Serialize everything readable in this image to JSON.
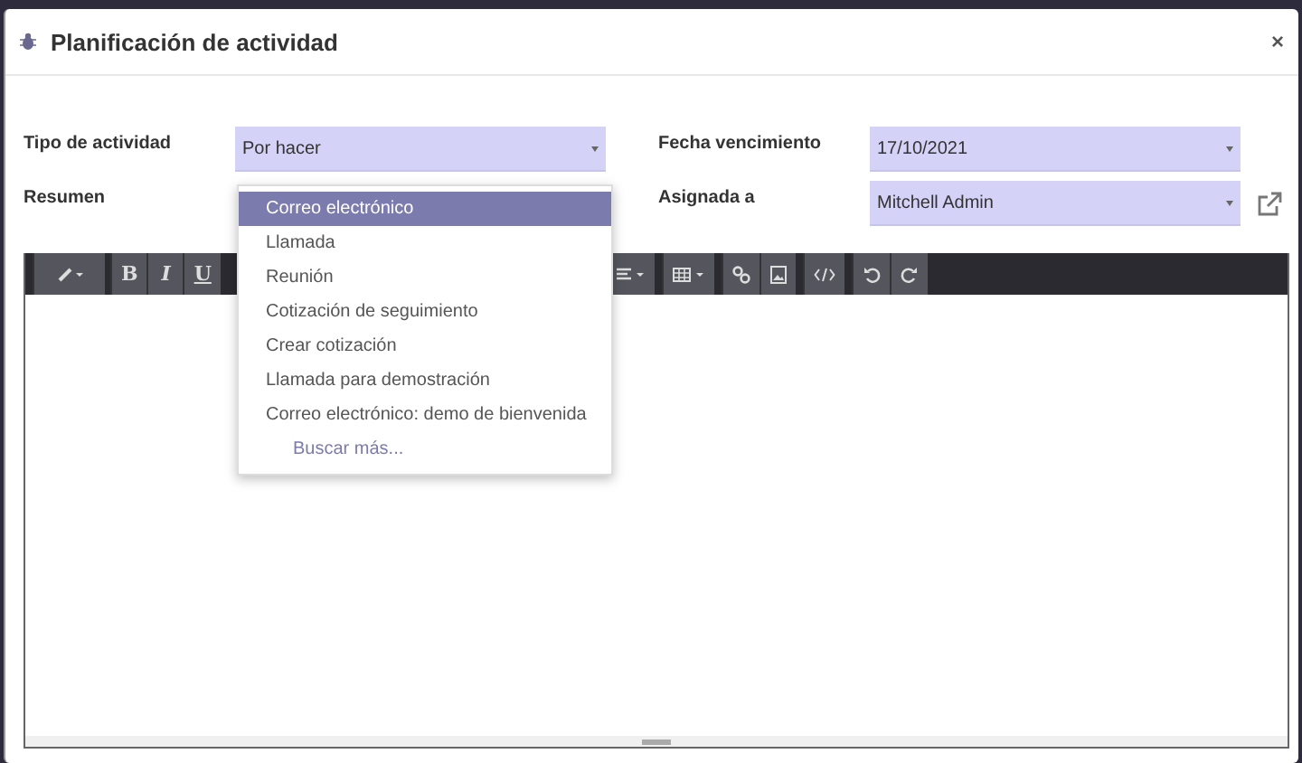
{
  "dialog": {
    "title": "Planificación de actividad",
    "close": "×"
  },
  "form": {
    "activity_type": {
      "label": "Tipo de actividad",
      "value": "Por hacer"
    },
    "summary": {
      "label": "Resumen"
    },
    "due_date": {
      "label": "Fecha vencimiento",
      "value": "17/10/2021"
    },
    "assigned_to": {
      "label": "Asignada a",
      "value": "Mitchell Admin"
    }
  },
  "dropdown": {
    "items": [
      {
        "label": "Correo electrónico",
        "kind": "option",
        "selected": true
      },
      {
        "label": "Llamada",
        "kind": "option",
        "selected": false
      },
      {
        "label": "Reunión",
        "kind": "option",
        "selected": false
      },
      {
        "label": "Cotización de seguimiento",
        "kind": "option",
        "selected": false
      },
      {
        "label": "Crear cotización",
        "kind": "option",
        "selected": false
      },
      {
        "label": "Llamada para demostración",
        "kind": "option",
        "selected": false
      },
      {
        "label": "Correo electrónico: demo de bienvenida",
        "kind": "option",
        "selected": false
      },
      {
        "label": "Buscar más...",
        "kind": "search_more",
        "selected": false
      }
    ]
  },
  "editor": {
    "toolbar_left": [
      {
        "kind": "style"
      },
      {
        "kind": "text",
        "label": "B"
      },
      {
        "kind": "text",
        "label": "I"
      },
      {
        "kind": "text",
        "label": "U"
      }
    ],
    "toolbar_right": [
      {
        "kind": "align"
      },
      {
        "kind": "table"
      },
      {
        "kind": "link"
      },
      {
        "kind": "image"
      },
      {
        "kind": "code"
      },
      {
        "kind": "undo"
      },
      {
        "kind": "redo"
      }
    ]
  }
}
